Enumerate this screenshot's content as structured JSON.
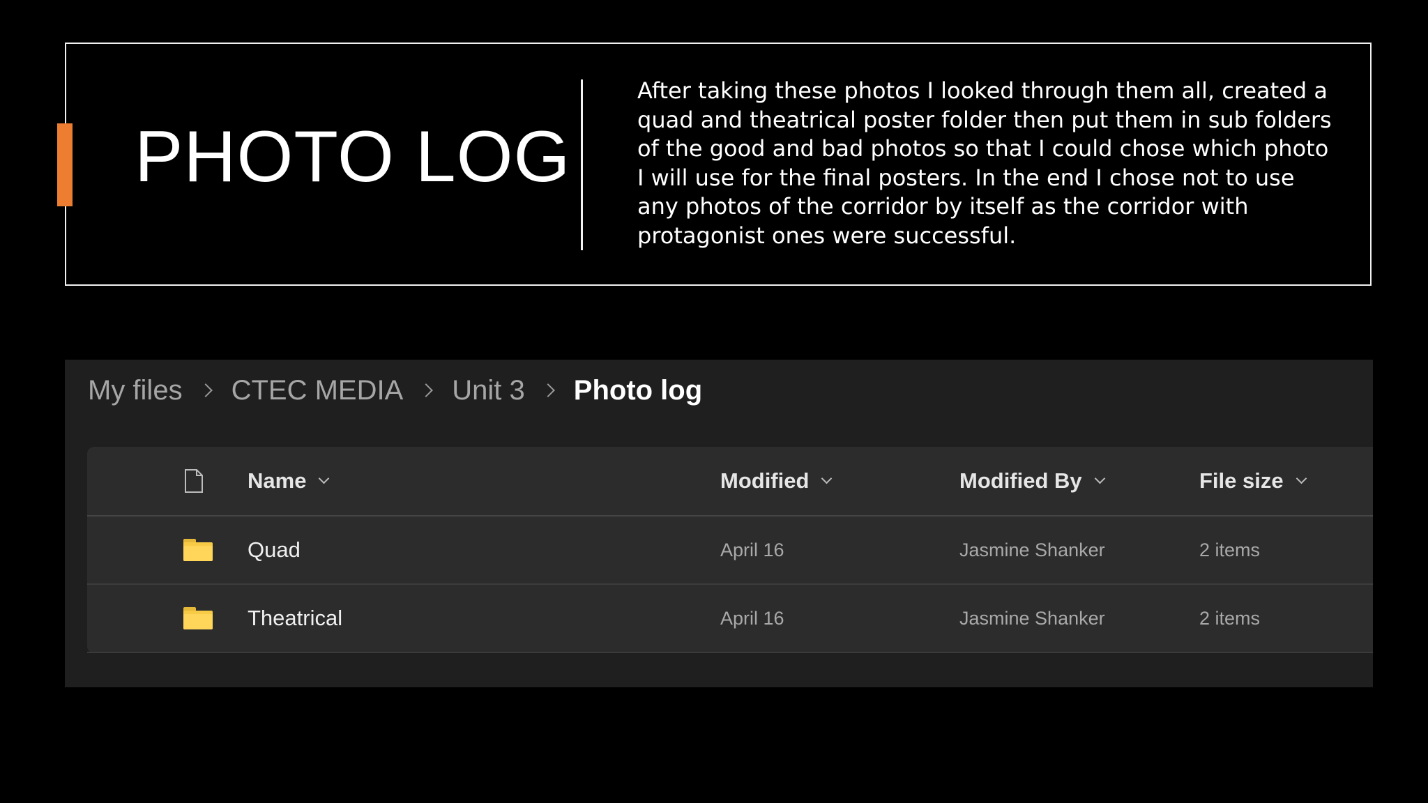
{
  "slide": {
    "title": "PHOTO LOG",
    "description": "After taking these photos I looked through them all, created a quad and theatrical poster folder then put them in sub folders of the good and bad photos so that I could chose which photo I will use for the final posters. In the end I chose not to use any photos of the corridor by itself as the corridor with protagonist ones were successful.",
    "accent_color": "#ed7d31"
  },
  "explorer": {
    "breadcrumb": [
      "My files",
      "CTEC MEDIA",
      "Unit 3"
    ],
    "breadcrumb_current": "Photo log",
    "columns": {
      "type_icon": "file-icon",
      "name": "Name",
      "modified": "Modified",
      "modified_by": "Modified By",
      "file_size": "File size"
    },
    "rows": [
      {
        "icon": "folder-icon",
        "name": "Quad",
        "modified": "April 16",
        "modified_by": "Jasmine Shanker",
        "file_size": "2 items"
      },
      {
        "icon": "folder-icon",
        "name": "Theatrical",
        "modified": "April 16",
        "modified_by": "Jasmine Shanker",
        "file_size": "2 items"
      }
    ],
    "folder_color": "#f8cb47"
  }
}
